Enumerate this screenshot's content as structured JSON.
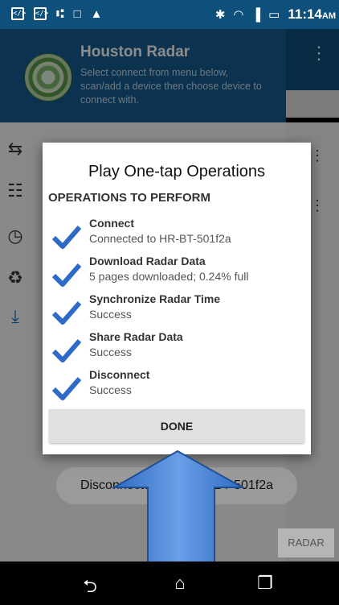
{
  "status_bar": {
    "time": "11:14",
    "ampm": "AM",
    "left_icons": [
      "code-icon",
      "code-icon",
      "usb-icon",
      "media-icon",
      "drive-icon"
    ],
    "right_icons": [
      "bluetooth-icon",
      "wifi-icon",
      "signal-icon",
      "battery-icon"
    ]
  },
  "drawer": {
    "title": "Houston Radar",
    "subtitle": "Select connect from menu below, scan/add a device then choose device to connect with.",
    "items": [
      {
        "icon": "swap-icon"
      },
      {
        "icon": "clipboard-icon"
      },
      {
        "icon": "clock-icon"
      },
      {
        "icon": "recycle-icon"
      },
      {
        "icon": "download-icon"
      }
    ]
  },
  "toast": {
    "text": "Disconnected from HR-BT-501f2a"
  },
  "bottom_tab": {
    "label": "RADAR"
  },
  "dialog": {
    "title": "Play One-tap Operations",
    "section_title": "OPERATIONS TO PERFORM",
    "operations": [
      {
        "name": "Connect",
        "status": "Connected to HR-BT-501f2a"
      },
      {
        "name": "Download Radar Data",
        "status": "5 pages downloaded; 0.24% full"
      },
      {
        "name": "Synchronize Radar Time",
        "status": "Success"
      },
      {
        "name": "Share Radar Data",
        "status": "Success"
      },
      {
        "name": "Disconnect",
        "status": "Success"
      }
    ],
    "done_label": "DONE"
  },
  "nav_bar": {
    "buttons": [
      "back-icon",
      "home-icon",
      "recents-icon"
    ]
  },
  "colors": {
    "primary": "#0f4f7c",
    "check": "#2d6bc6",
    "arrow": "#3f7ed8"
  }
}
